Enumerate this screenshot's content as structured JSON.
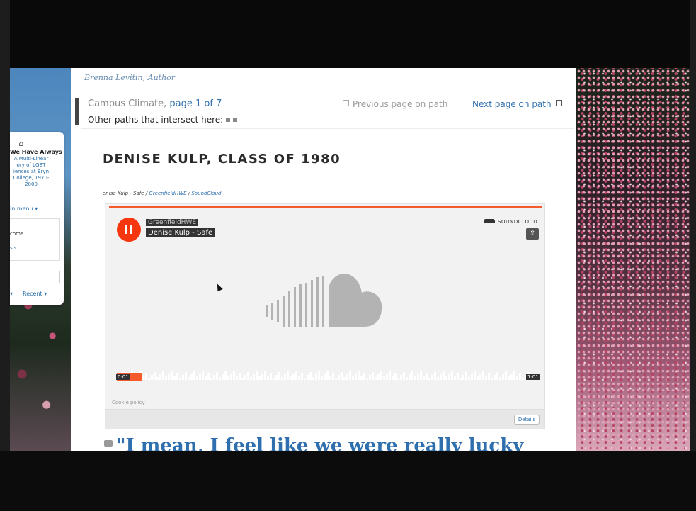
{
  "sidebar": {
    "title_line1": "We Have Always",
    "title_line2": "A Multi-Linear\nory of LGBT\niences at Bryn\nCollege, 1970-\n2000",
    "menu_label": "in menu ▾",
    "welcome_label": "come",
    "sis_label": "sis",
    "arrow_label": "▾",
    "recent_label": "Recent ▾"
  },
  "page": {
    "author": "Brenna Levitin, Author",
    "path": {
      "name": "Campus Climate,",
      "page_label": "page 1 of 7",
      "previous_label": "Previous page on path",
      "next_label": "Next page on path",
      "other_paths_label": "Other paths that intersect here:"
    },
    "heading": "DENISE KULP, CLASS OF 1980",
    "embed_caption": {
      "track": "enise Kulp - Safe /",
      "artist_link": "GreenfieldHWE",
      "service_link": "SoundCloud"
    },
    "quote": "\"I mean, I feel like we were really lucky"
  },
  "player": {
    "artist": "GreenfieldHWE",
    "track": "Denise Kulp - Safe",
    "logo": "SOUNDCLOUD",
    "time_current": "0:01",
    "time_duration": "1:01",
    "cookie_policy": "Cookie policy",
    "details_label": "Details",
    "progress_fraction": 0.06
  },
  "colors": {
    "accent": "#f5360e",
    "link": "#2f6fad"
  }
}
